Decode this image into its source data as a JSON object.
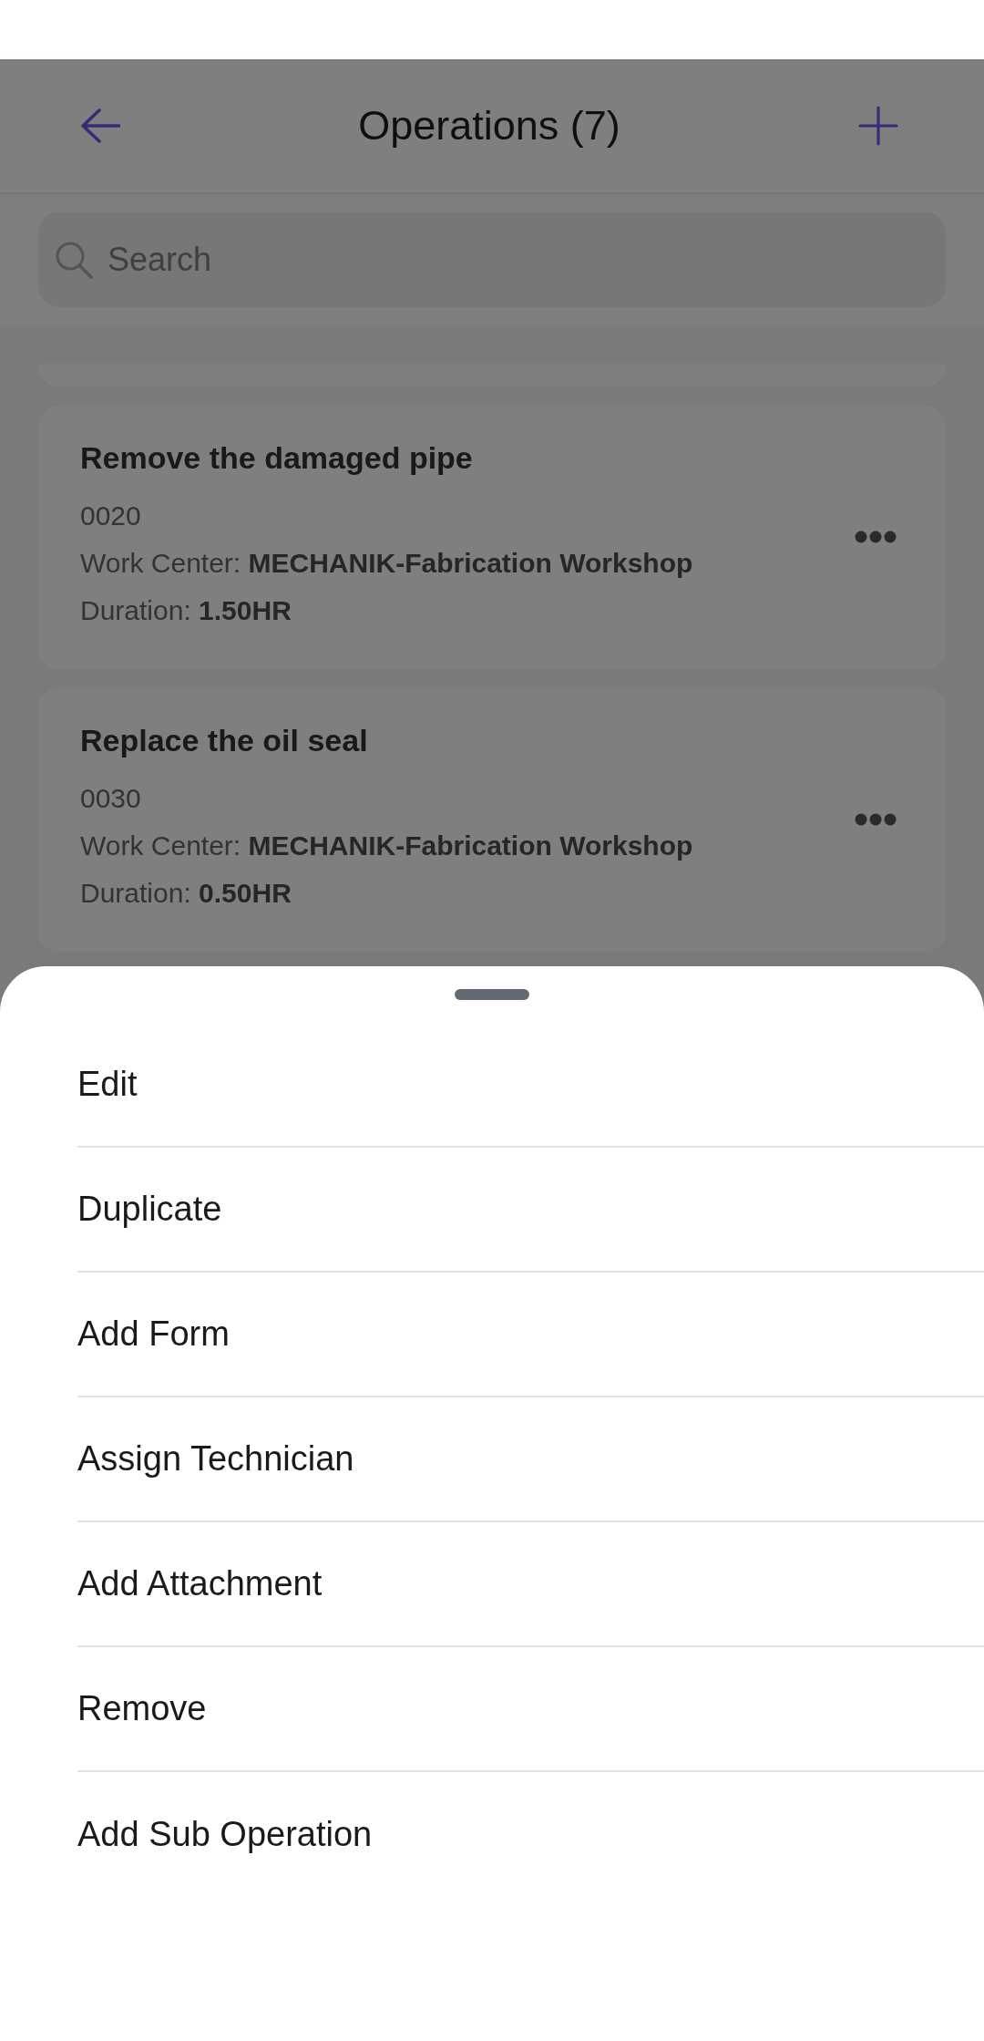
{
  "header": {
    "title": "Operations (7)"
  },
  "search": {
    "placeholder": "Search"
  },
  "operations": [
    {
      "title": "Remove the damaged pipe",
      "number": "0020",
      "work_center": "Work Center: **MECHANIK-Fabrication Workshop**",
      "duration": "Duration: **1.50HR**"
    },
    {
      "title": "Replace the oil seal",
      "number": "0030",
      "work_center": "Work Center: **MECHANIK-Fabrication Workshop**",
      "duration": "Duration: **0.50HR**"
    }
  ],
  "action_sheet": {
    "items": [
      "Edit",
      "Duplicate",
      "Add Form",
      "Assign Technician",
      "Add Attachment",
      "Remove",
      "Add Sub Operation"
    ]
  }
}
